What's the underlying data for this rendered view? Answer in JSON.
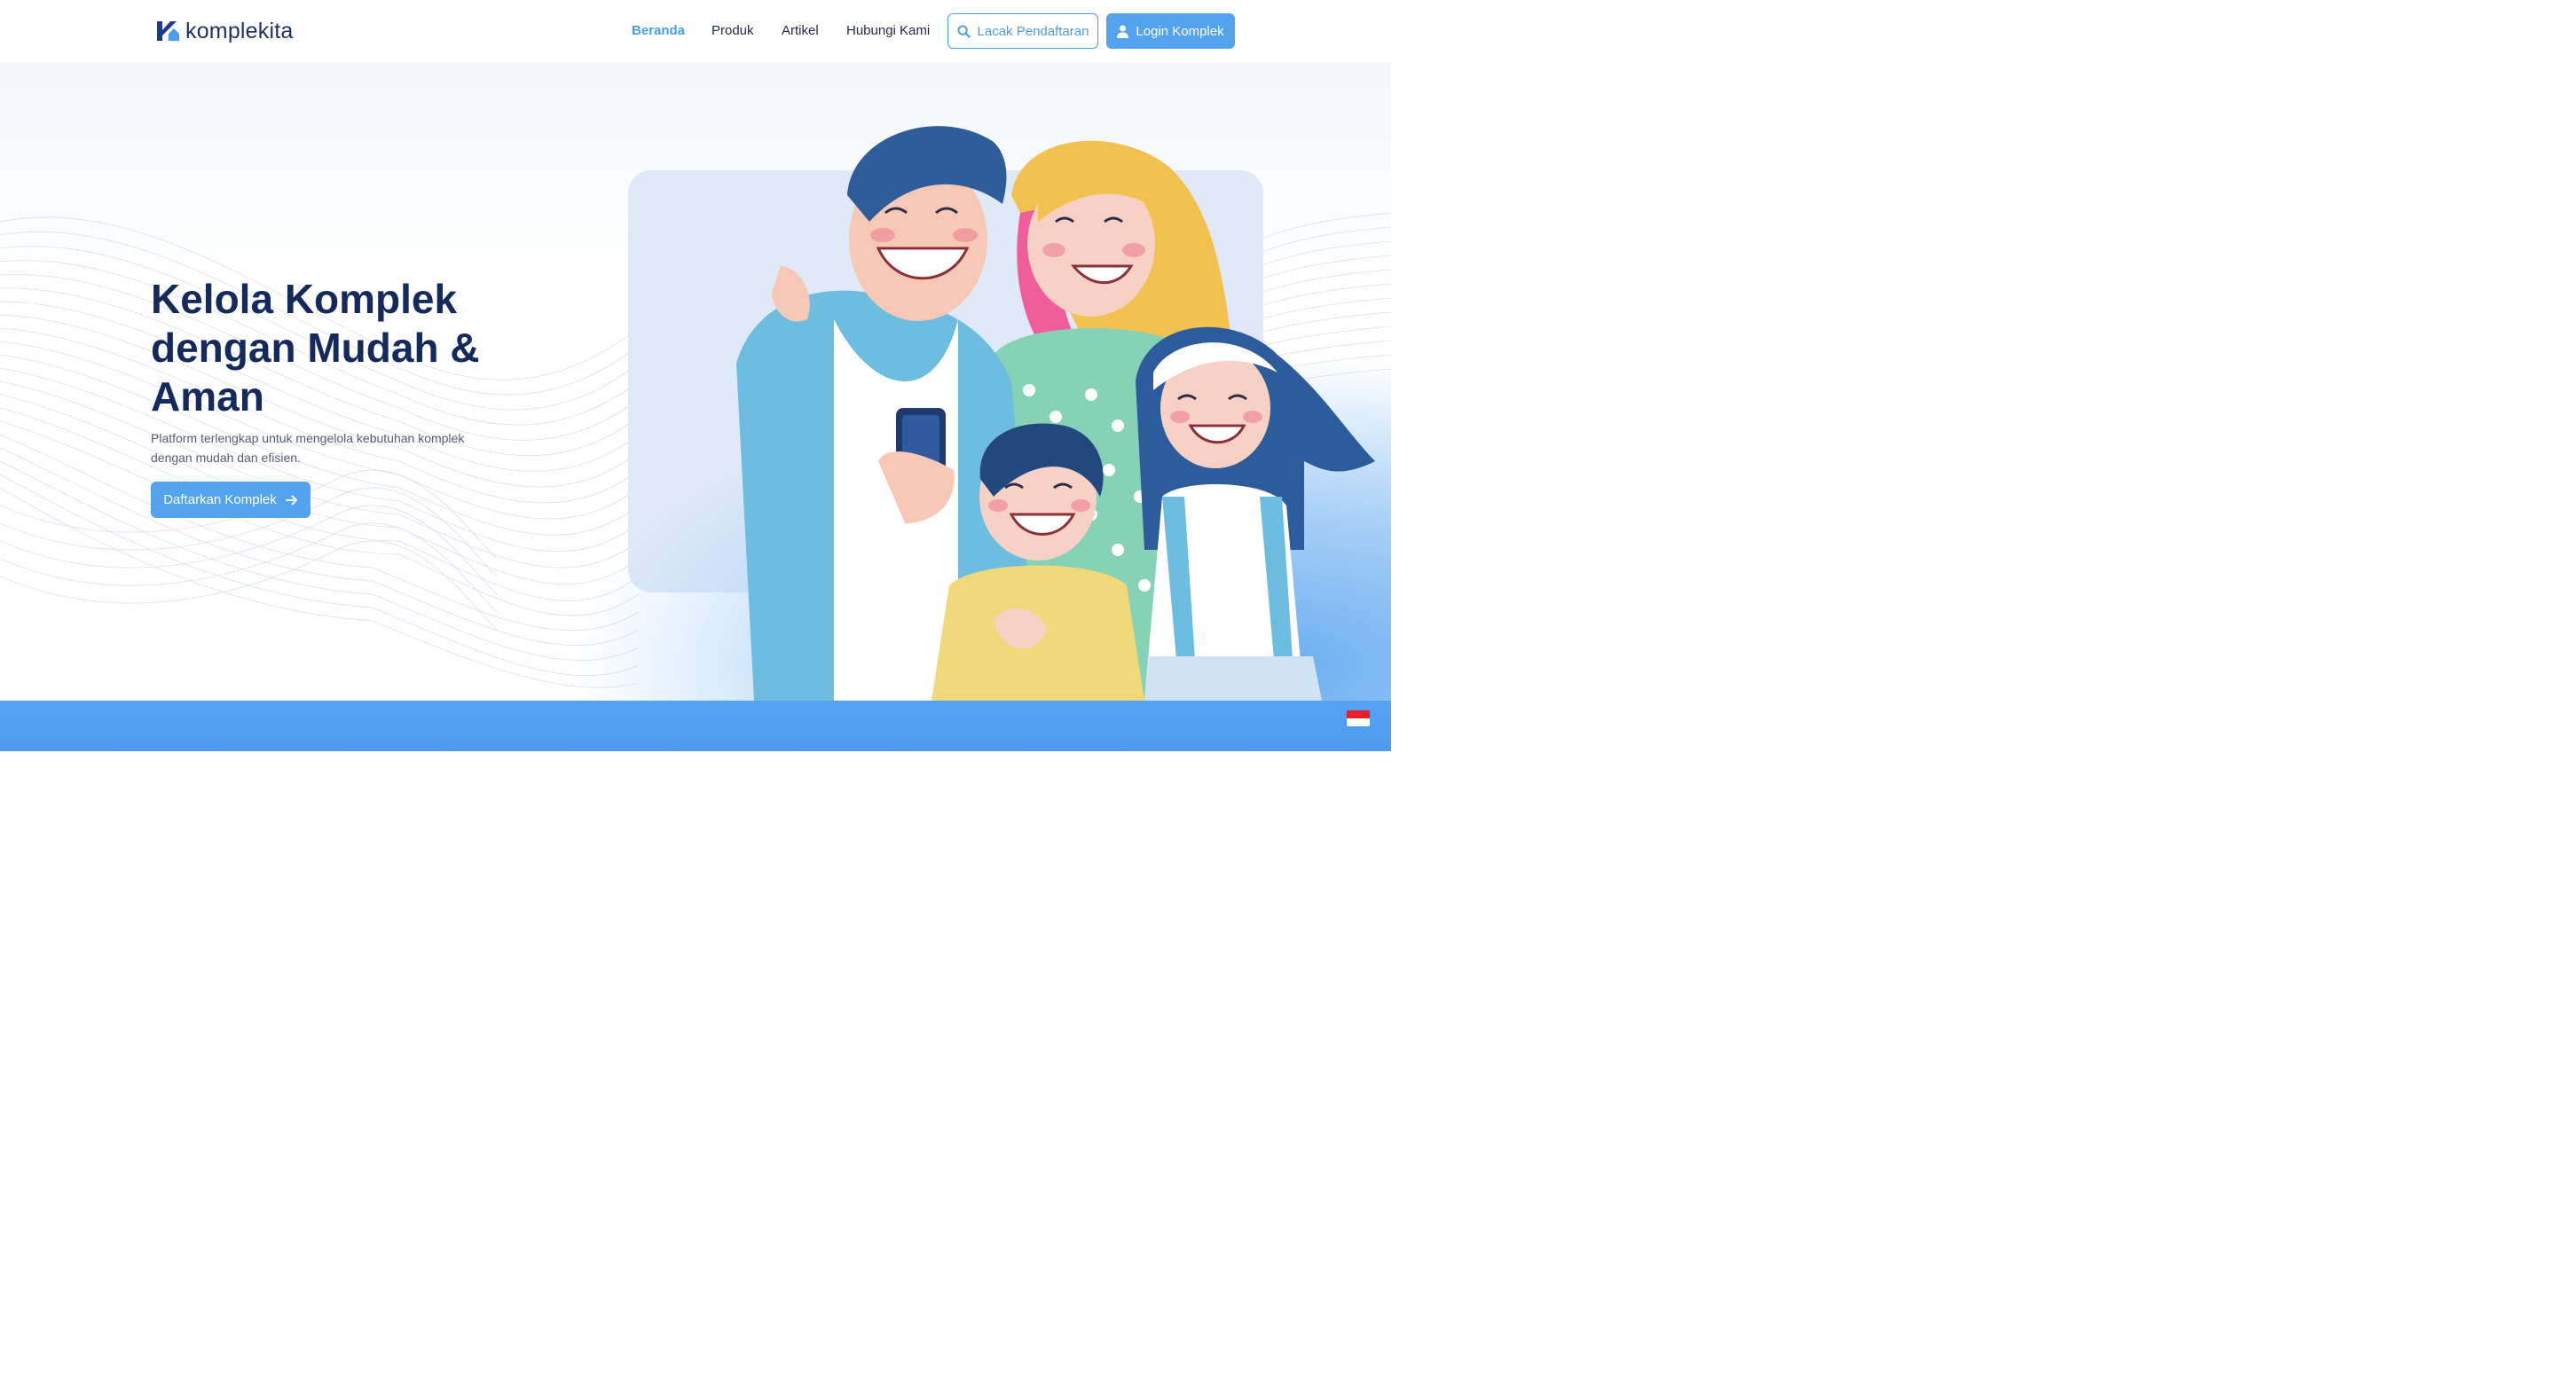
{
  "brand": {
    "name": "komplekita",
    "logo_icon": "komplekita-logo-icon",
    "primary_color": "#53a3ee",
    "heading_color": "#142a5c"
  },
  "nav": {
    "items": [
      {
        "label": "Beranda",
        "active": true
      },
      {
        "label": "Produk",
        "active": false
      },
      {
        "label": "Artikel",
        "active": false
      },
      {
        "label": "Hubungi Kami",
        "active": false
      }
    ],
    "track_button": {
      "label": "Lacak Pendaftaran",
      "icon": "search-icon"
    },
    "login_button": {
      "label": "Login Komplek",
      "icon": "user-icon"
    }
  },
  "hero": {
    "title": "Kelola Komplek dengan Mudah & Aman",
    "subtitle": "Platform terlengkap untuk mengelola kebutuhan komplek dengan mudah dan efisien.",
    "cta": {
      "label": "Daftarkan Komplek",
      "icon": "arrow-right-icon"
    },
    "illustration": "family-smiling-with-phone-illustration"
  },
  "language_switch": {
    "icon": "indonesia-flag-icon"
  }
}
